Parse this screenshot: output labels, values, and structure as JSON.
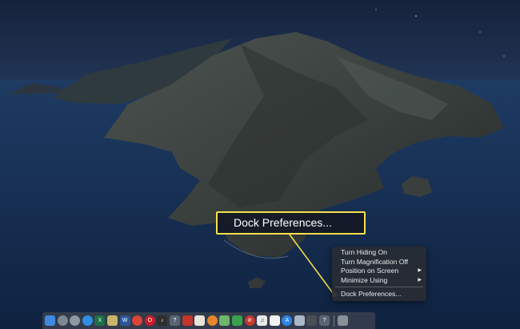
{
  "desktop": {
    "wallpaper": "macOS Catalina island wallpaper",
    "colors": {
      "sky": "#1b2c49",
      "sea": "#1d3a63",
      "island": "#3a3f3e"
    }
  },
  "context_menu": {
    "items": [
      {
        "label": "Turn Hiding On",
        "submenu": false
      },
      {
        "label": "Turn Magnification Off",
        "submenu": false
      },
      {
        "label": "Position on Screen",
        "submenu": true
      },
      {
        "label": "Minimize Using",
        "submenu": true
      }
    ],
    "last_item": {
      "label": "Dock Preferences..."
    },
    "submenu_arrow": "▶"
  },
  "callout": {
    "label": "Dock Preferences...",
    "accent": "#f5e04a"
  },
  "dock": {
    "apps": [
      {
        "name": "finder-icon",
        "color": "#3d8be0",
        "glyph": ""
      },
      {
        "name": "launchpad-icon",
        "color": "#7d8791",
        "glyph": "",
        "round": true
      },
      {
        "name": "system-preferences-icon",
        "color": "#8e98a3",
        "glyph": "",
        "round": true
      },
      {
        "name": "safari-icon",
        "color": "#2f8ee3",
        "glyph": "",
        "round": true
      },
      {
        "name": "excel-icon",
        "color": "#1e7145",
        "glyph": "X"
      },
      {
        "name": "notes-icon",
        "color": "#c9b56a",
        "glyph": ""
      },
      {
        "name": "word-icon",
        "color": "#2b579a",
        "glyph": "W"
      },
      {
        "name": "chrome-icon",
        "color": "#db4437",
        "glyph": "",
        "round": true
      },
      {
        "name": "opera-icon",
        "color": "#cc1b2a",
        "glyph": "O",
        "round": true
      },
      {
        "name": "itunes-icon",
        "color": "#2d2d2d",
        "glyph": "♪"
      },
      {
        "name": "help-icon",
        "color": "#5a6470",
        "glyph": "?"
      },
      {
        "name": "photo-booth-icon",
        "color": "#c2352b",
        "glyph": ""
      },
      {
        "name": "photos-icon",
        "color": "#e9e4da",
        "glyph": ""
      },
      {
        "name": "ibooks-icon",
        "color": "#e6852e",
        "glyph": "",
        "round": true
      },
      {
        "name": "maps-icon",
        "color": "#6db66a",
        "glyph": ""
      },
      {
        "name": "numbers-icon",
        "color": "#3aa14c",
        "glyph": ""
      },
      {
        "name": "no-entry-icon",
        "color": "#c6382e",
        "glyph": "⊘",
        "round": true
      },
      {
        "name": "music-icon",
        "color": "#e8e8ea",
        "glyph": "♫"
      },
      {
        "name": "calendar-icon",
        "color": "#f2f2f2",
        "glyph": ""
      },
      {
        "name": "app-store-icon",
        "color": "#2a86e8",
        "glyph": "A",
        "round": true
      },
      {
        "name": "preview-icon",
        "color": "#a9b7c8",
        "glyph": ""
      },
      {
        "name": "terminal-icon",
        "color": "#4a4f57",
        "glyph": ""
      },
      {
        "name": "help2-icon",
        "color": "#5a6470",
        "glyph": "?"
      }
    ],
    "trash": {
      "name": "trash-icon",
      "color": "#8a9099",
      "glyph": ""
    }
  }
}
